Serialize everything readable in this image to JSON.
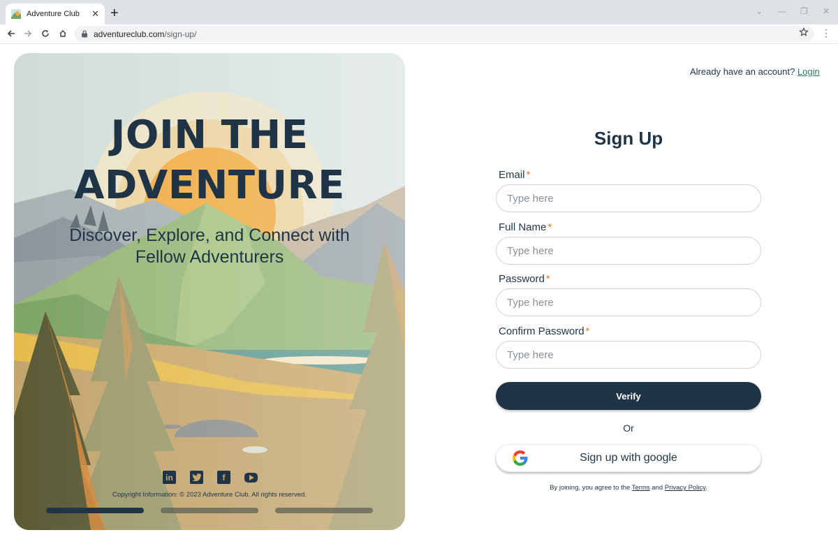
{
  "browser": {
    "tab_title": "Adventure Club",
    "url_host": "adventureclub.com",
    "url_path": "/sign-up/"
  },
  "hero": {
    "title_line1": "JOIN THE",
    "title_line2": "ADVENTURE",
    "subtitle": "Discover, Explore, and Connect with Fellow Adventurers",
    "socials": [
      "linkedin-icon",
      "twitter-icon",
      "facebook-icon",
      "youtube-icon"
    ],
    "copyright": "Copyright Information: © 2023 Adventure Club. All rights reserved.",
    "carousel_active_index": 0,
    "carousel_count": 3
  },
  "auth": {
    "already_text": "Already have an account?",
    "login_label": "Login"
  },
  "form": {
    "title": "Sign Up",
    "fields": [
      {
        "label": "Email",
        "required_mark": "*",
        "placeholder": "Type here"
      },
      {
        "label": "Full Name",
        "required_mark": "*",
        "placeholder": "Type here"
      },
      {
        "label": "Password",
        "required_mark": "*",
        "placeholder": "Type here"
      },
      {
        "label": "Confirm Password",
        "required_mark": "*",
        "placeholder": "Type here"
      }
    ],
    "verify_label": "Verify",
    "or_label": "Or",
    "google_label": "Sign up with google",
    "terms_prefix": "By joining, you agree to the",
    "terms_link": "Terms",
    "terms_and": "and",
    "privacy_link": "Privacy Policy",
    "terms_suffix": "."
  },
  "colors": {
    "primary": "#1f3547",
    "accent_required": "#e8772e",
    "login_link": "#2f7a62"
  }
}
